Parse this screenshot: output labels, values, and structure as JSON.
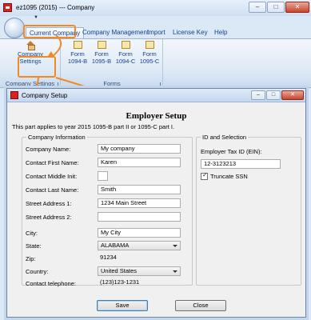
{
  "app": {
    "title": "ez1095 (2015) --- Company",
    "window_buttons": {
      "minimize": "–",
      "maximize": "□",
      "close": "✕"
    },
    "quick_access_arrow": "▼"
  },
  "menu": {
    "items": [
      "Current Company",
      "Company Management",
      "Import",
      "License Key",
      "Help"
    ]
  },
  "ribbon": {
    "groups": [
      {
        "label": "Company Settings",
        "buttons": [
          {
            "label": "Company Settings",
            "icon": "house-icon"
          }
        ]
      },
      {
        "label": "Forms",
        "buttons": [
          {
            "label": "Form 1094-B",
            "icon": "form-icon"
          },
          {
            "label": "Form 1095-B",
            "icon": "form-icon"
          },
          {
            "label": "Form 1094-C",
            "icon": "form-icon"
          },
          {
            "label": "Form 1095-C",
            "icon": "form-icon"
          }
        ]
      }
    ]
  },
  "background_logo": "1095",
  "dialog": {
    "title": "Company Setup",
    "window_buttons": {
      "minimize": "–",
      "maximize": "□",
      "close": "✕"
    },
    "heading": "Employer Setup",
    "note": "This part applies to year 2015 1095-B part II or 1095-C part I.",
    "company_info": {
      "legend": "Company Information",
      "fields": {
        "company_name": {
          "label": "Company Name:",
          "value": "My company"
        },
        "first_name": {
          "label": "Contact First Name:",
          "value": "Karen"
        },
        "middle_init": {
          "label": "Contact Middle Init:",
          "value": ""
        },
        "last_name": {
          "label": "Contact Last Name:",
          "value": "Smith"
        },
        "address1": {
          "label": "Street Address 1:",
          "value": "1234 Main Street"
        },
        "address2": {
          "label": "Street Address 2:",
          "value": ""
        },
        "city": {
          "label": "City:",
          "value": "My City"
        },
        "state": {
          "label": "State:",
          "value": "ALABAMA"
        },
        "zip": {
          "label": "Zip:",
          "value": "91234"
        },
        "country": {
          "label": "Country:",
          "value": "United States"
        },
        "telephone": {
          "label": "Contact telephone:",
          "value": "(123)123-1231"
        }
      }
    },
    "id_selection": {
      "legend": "ID and Selection",
      "ein_label": "Employer Tax ID (EIN):",
      "ein_value": "12-3123213",
      "truncate_label": "Truncate SSN",
      "truncate_checked": "✓"
    },
    "buttons": {
      "save": "Save",
      "close": "Close"
    }
  },
  "colors": {
    "callout": "#f08a24",
    "ribbon_text": "#15428b"
  }
}
